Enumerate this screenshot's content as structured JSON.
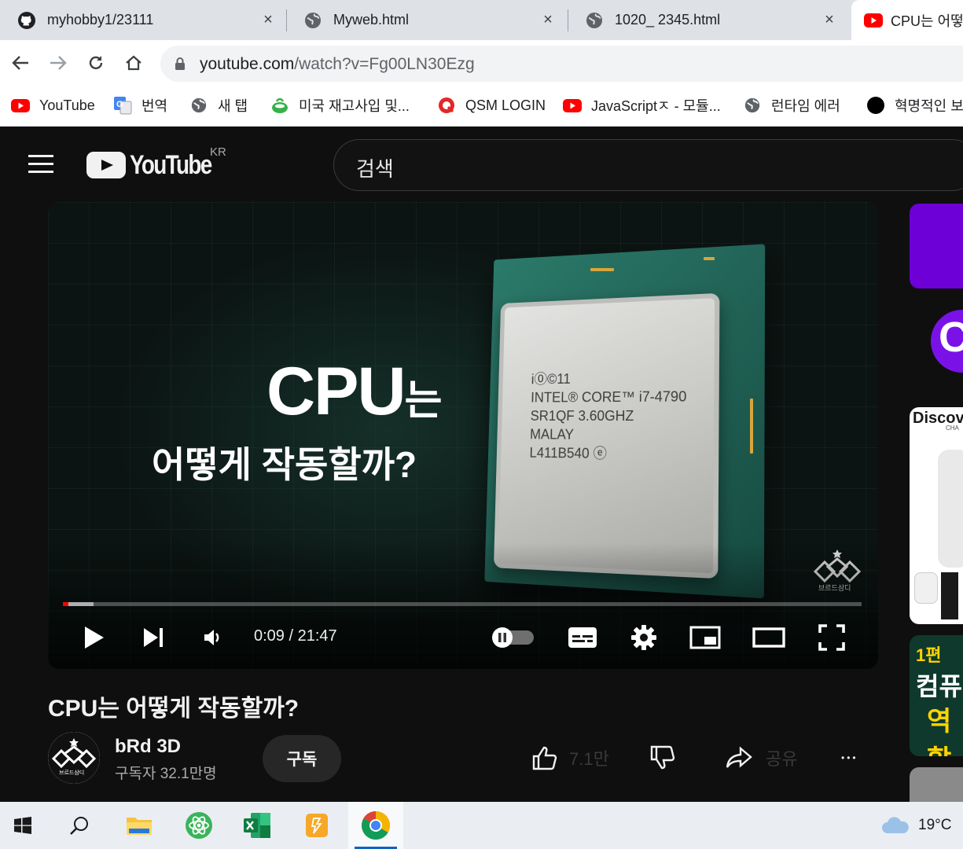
{
  "browser": {
    "tabs": [
      {
        "title": "myhobby1/23111",
        "icon": "github-icon"
      },
      {
        "title": "Myweb.html",
        "icon": "globe-icon"
      },
      {
        "title": "1020_ 2345.html",
        "icon": "globe-icon"
      },
      {
        "title": "CPU는 어떻",
        "icon": "youtube-icon",
        "active": true
      }
    ],
    "close_glyph": "×",
    "url_host": "youtube.com",
    "url_path": "/watch?v=Fg00LN30Ezg",
    "bookmarks": [
      {
        "label": "YouTube",
        "icon": "youtube-icon"
      },
      {
        "label": "번역",
        "icon": "translate-icon"
      },
      {
        "label": "새 탭",
        "icon": "globe-icon"
      },
      {
        "label": "미국 재고사입 및...",
        "icon": "cup-icon"
      },
      {
        "label": "QSM LOGIN",
        "icon": "qsm-icon"
      },
      {
        "label": "JavaScriptㅈ - 모듈...",
        "icon": "youtube-icon"
      },
      {
        "label": "런타임 에러",
        "icon": "globe-icon"
      },
      {
        "label": "혁명적인 보",
        "icon": "black-circle-icon"
      }
    ]
  },
  "youtube": {
    "logo_text": "YouTube",
    "region": "KR",
    "search_placeholder": "검색",
    "player": {
      "overlay_title_big": "CPU",
      "overlay_title_suffix": "는",
      "overlay_subtitle": "어떻게 작동할까?",
      "chip_engraving": "i⓪©11\nINTEL® CORE™ i7-4790\nSR1QF 3.60GHZ\nMALAY\nL411B540 ⓔ",
      "watermark_label": "브르드삼디",
      "current_time": "0:09",
      "duration": "21:47",
      "time_text": "0:09 / 21:47",
      "played_fraction": 0.007,
      "buffered_fraction": 0.038
    },
    "video_title": "CPU는 어떻게 작동할까?",
    "channel": {
      "name": "bRd 3D",
      "subscribers": "구독자 32.1만명",
      "subscribe_label": "구독"
    },
    "actions": {
      "like_count": "7.1만",
      "share_label": "공유",
      "more_glyph": "•••"
    },
    "sidebar": {
      "badge_letter": "C",
      "ad_brand": "Discov",
      "ad_brand_sub": "CHA",
      "thumb_episode": "1편",
      "thumb_line1": "컴퓨",
      "thumb_line2": "역할"
    }
  },
  "taskbar": {
    "weather_temp": "19°C"
  },
  "colors": {
    "yt_red": "#ff0000",
    "yt_bg": "#0f0f0f",
    "tab_strip": "#dee1e6",
    "pcb_green": "#1f5e52"
  }
}
